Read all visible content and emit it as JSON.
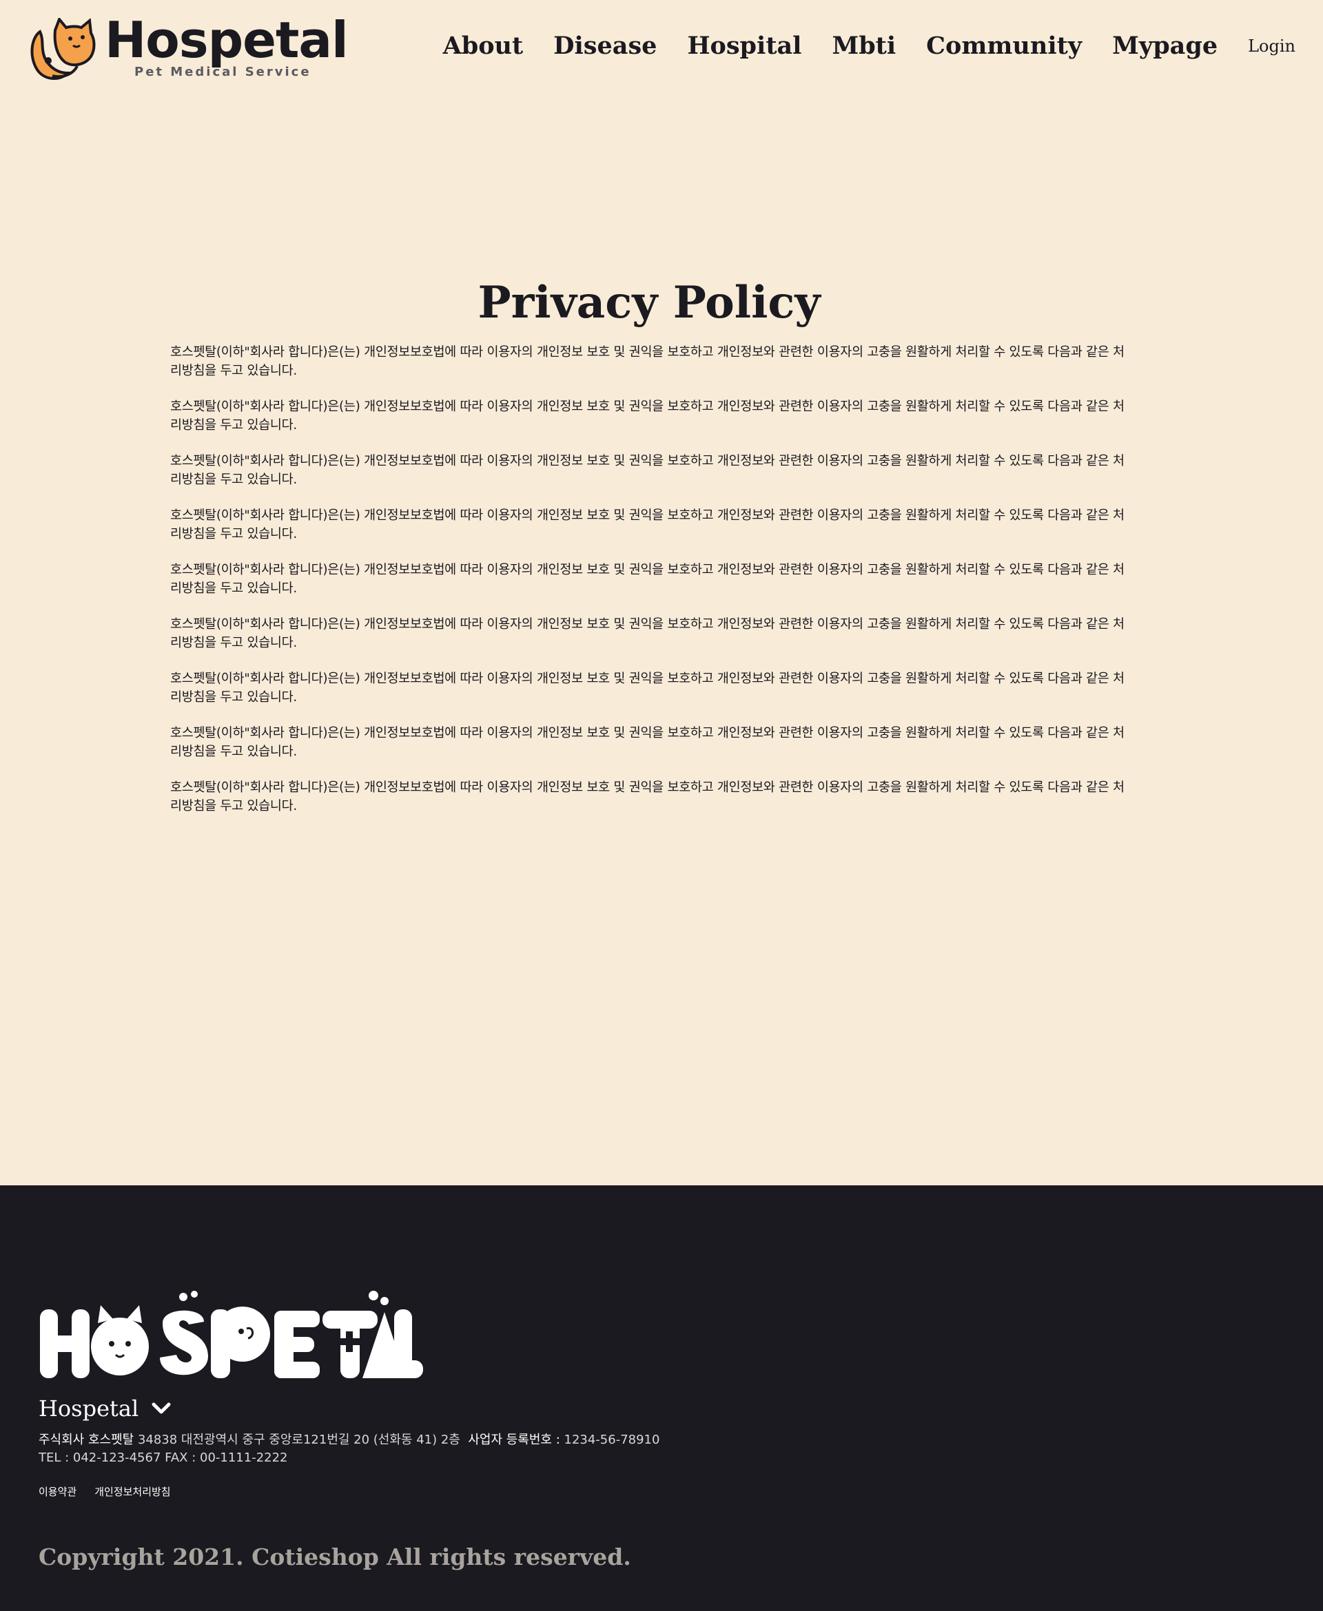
{
  "header": {
    "logo_text": "Hospetal",
    "logo_subtitle": "Pet Medical Service",
    "nav": [
      {
        "label": "About"
      },
      {
        "label": "Disease"
      },
      {
        "label": "Hospital"
      },
      {
        "label": "Mbti"
      },
      {
        "label": "Community"
      },
      {
        "label": "Mypage"
      }
    ],
    "login_label": "Login"
  },
  "main": {
    "title": "Privacy Policy",
    "paragraphs": [
      "호스펫탈(이하\"회사라 합니다)은(는) 개인정보보호법에 따라 이용자의 개인정보 보호 및 권익을 보호하고 개인정보와 관련한 이용자의 고충을 원활하게 처리할 수 있도록 다음과 같은 처리방침을 두고 있습니다.",
      "호스펫탈(이하\"회사라 합니다)은(는) 개인정보보호법에 따라 이용자의 개인정보 보호 및 권익을 보호하고 개인정보와 관련한 이용자의 고충을 원활하게 처리할 수 있도록 다음과 같은 처리방침을 두고 있습니다.",
      "호스펫탈(이하\"회사라 합니다)은(는) 개인정보보호법에 따라 이용자의 개인정보 보호 및 권익을 보호하고 개인정보와 관련한 이용자의 고충을 원활하게 처리할 수 있도록 다음과 같은 처리방침을 두고 있습니다.",
      "호스펫탈(이하\"회사라 합니다)은(는) 개인정보보호법에 따라 이용자의 개인정보 보호 및 권익을 보호하고 개인정보와 관련한 이용자의 고충을 원활하게 처리할 수 있도록 다음과 같은 처리방침을 두고 있습니다.",
      "호스펫탈(이하\"회사라 합니다)은(는) 개인정보보호법에 따라 이용자의 개인정보 보호 및 권익을 보호하고 개인정보와 관련한 이용자의 고충을 원활하게 처리할 수 있도록 다음과 같은 처리방침을 두고 있습니다.",
      "호스펫탈(이하\"회사라 합니다)은(는) 개인정보보호법에 따라 이용자의 개인정보 보호 및 권익을 보호하고 개인정보와 관련한 이용자의 고충을 원활하게 처리할 수 있도록 다음과 같은 처리방침을 두고 있습니다.",
      "호스펫탈(이하\"회사라 합니다)은(는) 개인정보보호법에 따라 이용자의 개인정보 보호 및 권익을 보호하고 개인정보와 관련한 이용자의 고충을 원활하게 처리할 수 있도록 다음과 같은 처리방침을 두고 있습니다.",
      "호스펫탈(이하\"회사라 합니다)은(는) 개인정보보호법에 따라 이용자의 개인정보 보호 및 권익을 보호하고 개인정보와 관련한 이용자의 고충을 원활하게 처리할 수 있도록 다음과 같은 처리방침을 두고 있습니다.",
      "호스펫탈(이하\"회사라 합니다)은(는) 개인정보보호법에 따라 이용자의 개인정보 보호 및 권익을 보호하고 개인정보와 관련한 이용자의 고충을 원활하게 처리할 수 있도록 다음과 같은 처리방침을 두고 있습니다."
    ]
  },
  "footer": {
    "logo_text": "HOSPETAL",
    "brand": "Hospetal",
    "company_label": "주식회사 호스펫탈",
    "address": "34838 대전광역시 중구 중앙로121번길 20 (선화동 41) 2층",
    "biz_label": "사업자 등록번호 :",
    "biz_number": "1234-56-78910",
    "tel_line": "TEL : 042-123-4567 FAX : 00-1111-2222",
    "links": [
      {
        "label": "이용약관"
      },
      {
        "label": "개인정보처리방침"
      }
    ],
    "copyright": "Copyright 2021. Cotieshop All rights reserved."
  },
  "colors": {
    "background": "#f8ebd8",
    "footer_bg": "#1b1a20",
    "accent_orange": "#f5a04a",
    "text_dark": "#1b1a20"
  }
}
